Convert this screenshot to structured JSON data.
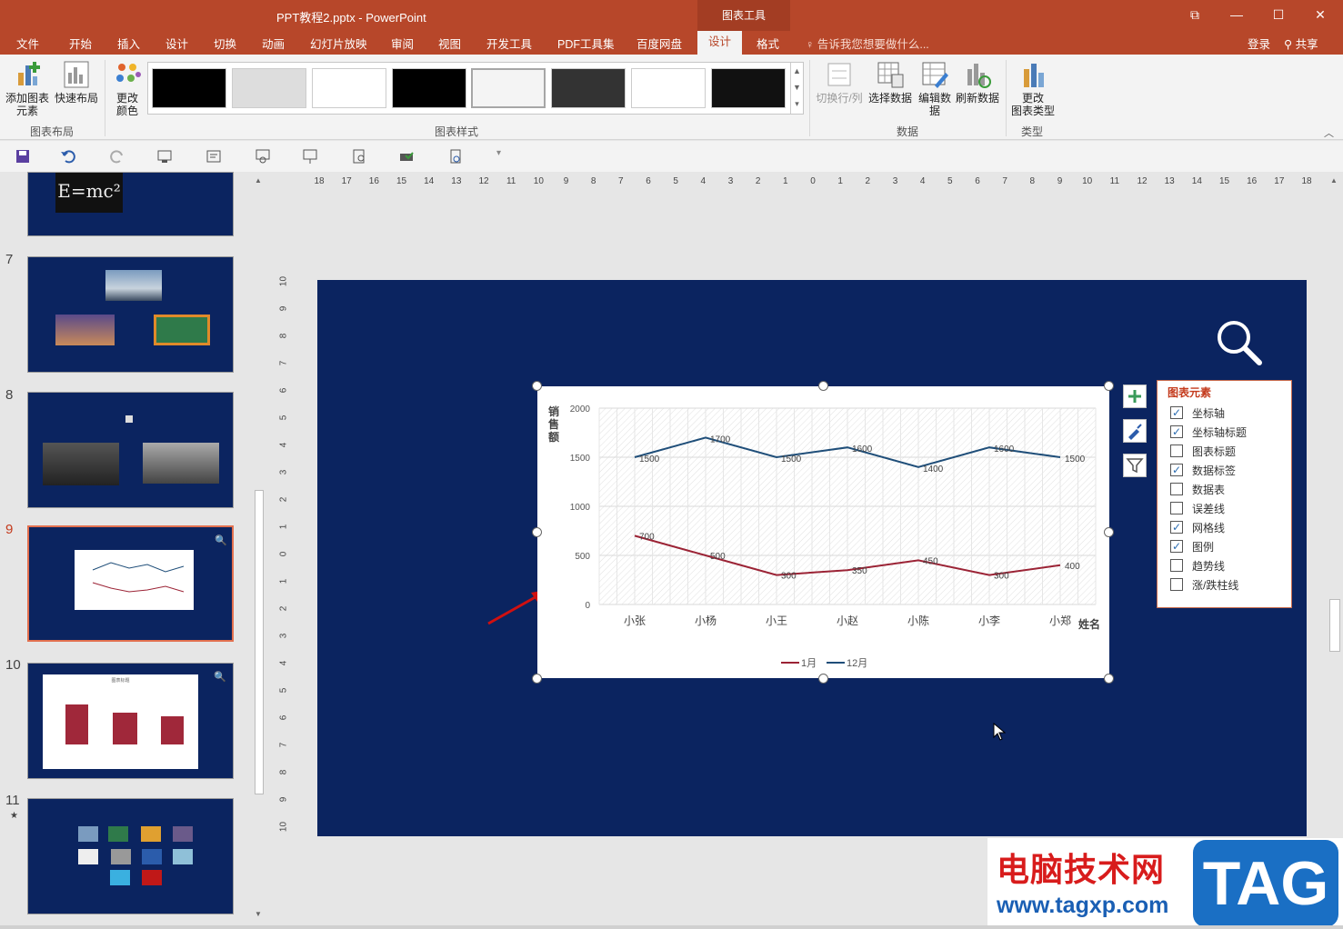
{
  "window": {
    "title": "PPT教程2.pptx - PowerPoint",
    "context_tab_group": "图表工具",
    "controls": [
      "⧉",
      "—",
      "☐",
      "✕"
    ]
  },
  "tabs": [
    "文件",
    "开始",
    "插入",
    "设计",
    "切换",
    "动画",
    "幻灯片放映",
    "审阅",
    "视图",
    "开发工具",
    "PDF工具集",
    "百度网盘",
    "设计",
    "格式"
  ],
  "active_tab": "设计",
  "tell_me": "告诉我您想要做什么...",
  "account": {
    "login": "登录",
    "share": "共享"
  },
  "ribbon": {
    "add_element": "添加图表\n元素",
    "quick_layout": "快速布局",
    "group_layout": "图表布局",
    "change_colors": "更改\n颜色",
    "group_styles": "图表样式",
    "switch_row_col": "切换行/列",
    "select_data": "选择数据",
    "edit_data": "编辑数\n据",
    "refresh_data": "刷新数据",
    "group_data": "数据",
    "change_type": "更改\n图表类型",
    "group_type": "类型"
  },
  "slides": [
    {
      "num": "",
      "label": "E=mc²"
    },
    {
      "num": "7"
    },
    {
      "num": "8"
    },
    {
      "num": "9"
    },
    {
      "num": "10",
      "label": "图表标题"
    },
    {
      "num": "11",
      "star": "★"
    }
  ],
  "ruler": {
    "h": [
      "18",
      "17",
      "16",
      "15",
      "14",
      "13",
      "12",
      "11",
      "10",
      "9",
      "8",
      "7",
      "6",
      "5",
      "4",
      "3",
      "2",
      "1",
      "0",
      "1",
      "2",
      "3",
      "4",
      "5",
      "6",
      "7",
      "8",
      "9",
      "10",
      "11",
      "12",
      "13",
      "14",
      "15",
      "16",
      "17",
      "18"
    ],
    "v": [
      "10",
      "9",
      "8",
      "7",
      "6",
      "5",
      "4",
      "3",
      "2",
      "1",
      "0",
      "1",
      "2",
      "3",
      "4",
      "5",
      "6",
      "7",
      "8",
      "9",
      "10"
    ]
  },
  "chart_data": {
    "type": "line",
    "categories": [
      "小张",
      "小杨",
      "小王",
      "小赵",
      "小陈",
      "小李",
      "小郑"
    ],
    "series": [
      {
        "name": "1月",
        "values": [
          700,
          500,
          300,
          350,
          450,
          300,
          400
        ],
        "color": "#9b2335"
      },
      {
        "name": "12月",
        "values": [
          1500,
          1700,
          1500,
          1600,
          1400,
          1600,
          1500
        ],
        "color": "#1f4e79"
      }
    ],
    "ylabel": "销售额",
    "xlabel": "姓名",
    "yticks": [
      "0",
      "500",
      "1000",
      "1500",
      "2000"
    ],
    "ylim": [
      0,
      2000
    ],
    "grid": true,
    "legend": "bottom",
    "data_labels": true
  },
  "elements_panel": {
    "title": "图表元素",
    "items": [
      {
        "label": "坐标轴",
        "checked": true
      },
      {
        "label": "坐标轴标题",
        "checked": true
      },
      {
        "label": "图表标题",
        "checked": false
      },
      {
        "label": "数据标签",
        "checked": true
      },
      {
        "label": "数据表",
        "checked": false
      },
      {
        "label": "误差线",
        "checked": false
      },
      {
        "label": "网格线",
        "checked": true
      },
      {
        "label": "图例",
        "checked": true
      },
      {
        "label": "趋势线",
        "checked": false
      },
      {
        "label": "涨/跌柱线",
        "checked": false
      }
    ]
  },
  "watermark": {
    "cn": "电脑技术网",
    "url": "www.tagxp.com",
    "tag": "TAG"
  }
}
